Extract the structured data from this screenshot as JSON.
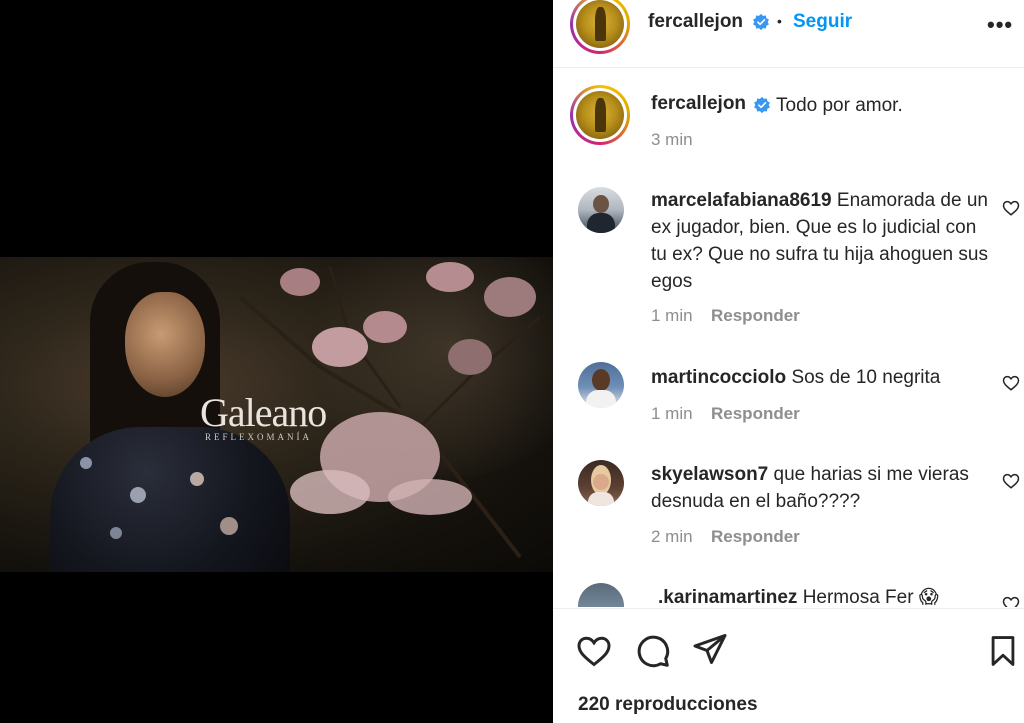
{
  "media": {
    "watermark_title": "Galeano",
    "watermark_subtitle": "REFLEXOMANÍA"
  },
  "header": {
    "username": "fercallejon",
    "separator": "•",
    "follow_label": "Seguir",
    "more_label": "•••"
  },
  "caption": {
    "username": "fercallejon",
    "text": "Todo por amor.",
    "time": "3 min"
  },
  "comments": [
    {
      "username": "marcelafabiana8619",
      "text": "Enamorada de un ex jugador, bien. Que es lo judicial con tu ex? Que no sufra tu hija ahoguen sus egos",
      "time": "1 min",
      "reply_label": "Responder"
    },
    {
      "username": "martincocciolo",
      "text": "Sos de 10 negrita",
      "time": "1 min",
      "reply_label": "Responder"
    },
    {
      "username": "skyelawson7",
      "text": "que harias si me vieras desnuda en el baño????",
      "time": "2 min",
      "reply_label": "Responder"
    },
    {
      "username": ".karinamartinez",
      "text": "Hermosa Fer 😱",
      "time": "",
      "reply_label": ""
    }
  ],
  "actions": {
    "views": "220 reproducciones"
  },
  "colors": {
    "link_blue": "#0095f6",
    "verified_blue": "#3897f0",
    "secondary_text": "#8e8e8e"
  }
}
